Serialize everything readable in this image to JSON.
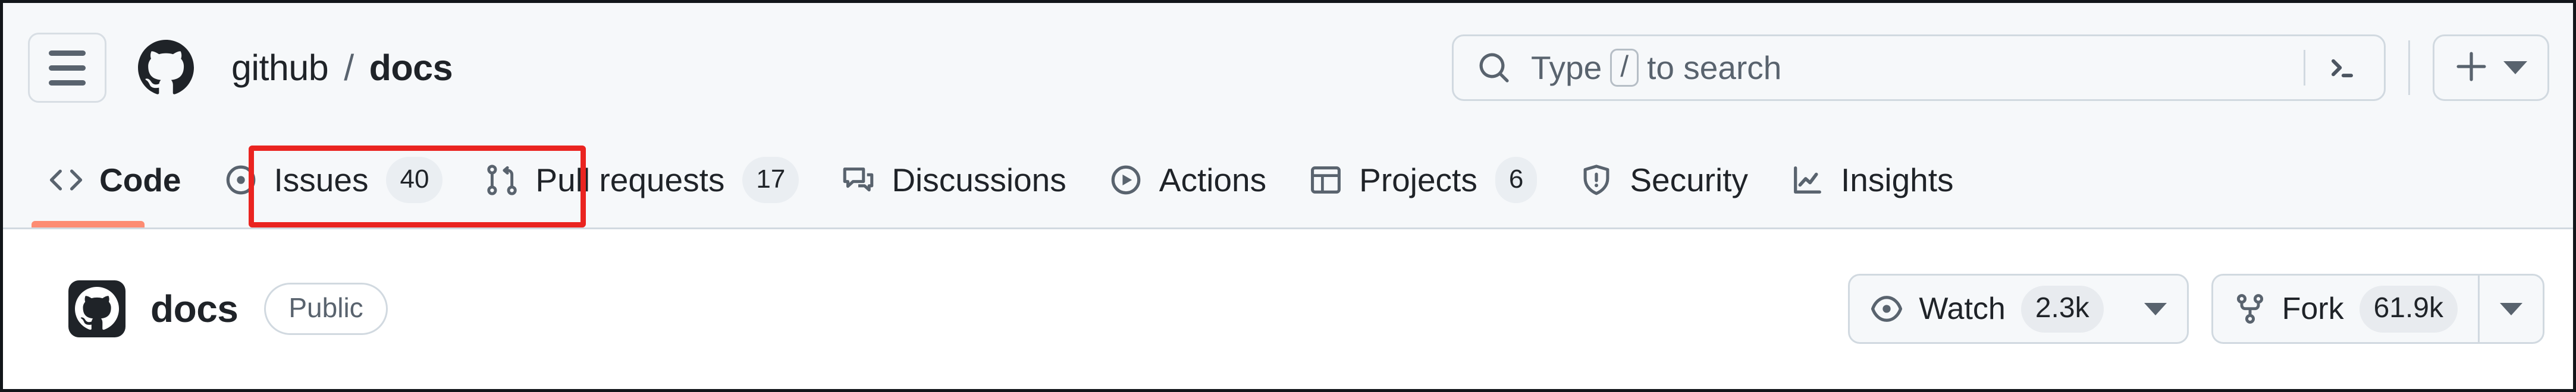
{
  "window": {
    "header_bg": "#f6f8fa",
    "body_bg": "#ffffff",
    "accent_underline": "#fd8c73",
    "annotation_color": "#ea2420"
  },
  "header": {
    "menu_button": "menu-button",
    "logo": "github-logo",
    "breadcrumb": {
      "owner": "github",
      "separator": "/",
      "repo": "docs"
    },
    "search": {
      "placeholder_prefix": "Type",
      "kbd": "/",
      "placeholder_suffix": "to search",
      "search_icon": "search-icon",
      "terminal_icon": "terminal-icon"
    },
    "create": {
      "plus_icon": "plus-icon",
      "caret_icon": "chevron-down-icon"
    }
  },
  "nav": {
    "active_tab": "Code",
    "tabs": [
      {
        "label": "Code",
        "icon": "code-icon",
        "count": "",
        "active": true
      },
      {
        "label": "Issues",
        "icon": "issue-opened-icon",
        "count": "40",
        "active": false
      },
      {
        "label": "Pull requests",
        "icon": "git-pull-request-icon",
        "count": "17",
        "active": false
      },
      {
        "label": "Discussions",
        "icon": "comment-discussion-icon",
        "count": "",
        "active": false
      },
      {
        "label": "Actions",
        "icon": "play-icon",
        "count": "",
        "active": false
      },
      {
        "label": "Projects",
        "icon": "table-icon",
        "count": "6",
        "active": false
      },
      {
        "label": "Security",
        "icon": "shield-icon",
        "count": "",
        "active": false
      },
      {
        "label": "Insights",
        "icon": "graph-icon",
        "count": "",
        "active": false
      }
    ],
    "annotation": {
      "target": "Issues",
      "shape": "rectangle"
    }
  },
  "repo": {
    "avatar": "octocat-avatar",
    "name": "docs",
    "visibility": "Public",
    "watch": {
      "label": "Watch",
      "count": "2.3k",
      "icon": "eye-icon",
      "caret_icon": "chevron-down-icon"
    },
    "fork": {
      "label": "Fork",
      "count": "61.9k",
      "icon": "repo-forked-icon",
      "caret_icon": "chevron-down-icon"
    }
  }
}
